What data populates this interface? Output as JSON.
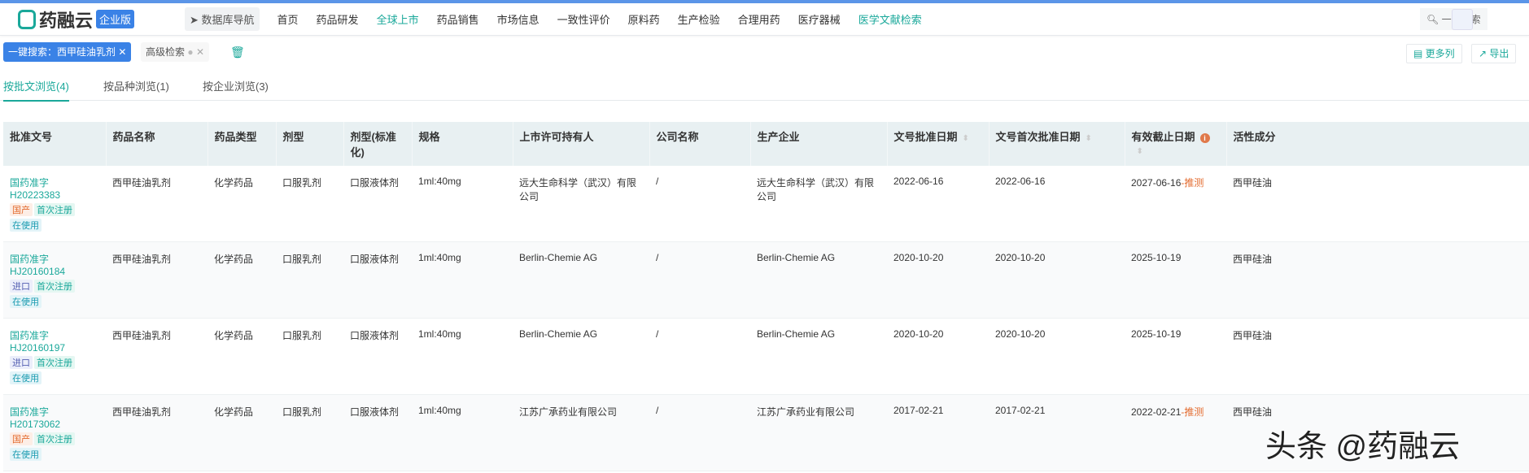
{
  "header": {
    "logo": "药融云",
    "edition": "企业版",
    "db_nav": "数据库导航",
    "nav": [
      "首页",
      "药品研发",
      "全球上市",
      "药品销售",
      "市场信息",
      "一致性评价",
      "原料药",
      "生产检验",
      "合理用药",
      "医疗器械",
      "医学文献检索"
    ],
    "active_nav": "全球上市",
    "search": "一键搜索"
  },
  "filters": {
    "chip": "一键搜索：西甲硅油乳剂",
    "advanced": "高级检索",
    "more_cols": "更多列",
    "export": "导出"
  },
  "tabs": [
    "按批文浏览(4)",
    "按品种浏览(1)",
    "按企业浏览(3)"
  ],
  "table": {
    "columns": [
      "批准文号",
      "药品名称",
      "药品类型",
      "剂型",
      "剂型(标准化)",
      "规格",
      "上市许可持有人",
      "公司名称",
      "生产企业",
      "文号批准日期",
      "文号首次批准日期",
      "有效截止日期",
      "活性成分"
    ],
    "rows": [
      {
        "no": "国药准字H20223383",
        "tags": [
          "国产",
          "首次注册",
          "在使用"
        ],
        "name": "西甲硅油乳剂",
        "type": "化学药品",
        "form": "口服乳剂",
        "form_std": "口服液体剂",
        "spec": "1ml:40mg",
        "holder": "远大生命科学（武汉）有限公司",
        "company": "/",
        "maker": "远大生命科学（武汉）有限公司",
        "date": "2022-06-16",
        "first_date": "2022-06-16",
        "expire": "2027-06-16",
        "guess": "-推测",
        "active": "西甲硅油"
      },
      {
        "no": "国药准字HJ20160184",
        "tags": [
          "进口",
          "首次注册",
          "在使用"
        ],
        "name": "西甲硅油乳剂",
        "type": "化学药品",
        "form": "口服乳剂",
        "form_std": "口服液体剂",
        "spec": "1ml:40mg",
        "holder": "Berlin-Chemie AG",
        "company": "/",
        "maker": "Berlin-Chemie AG",
        "date": "2020-10-20",
        "first_date": "2020-10-20",
        "expire": "2025-10-19",
        "guess": "",
        "active": "西甲硅油"
      },
      {
        "no": "国药准字HJ20160197",
        "tags": [
          "进口",
          "首次注册",
          "在使用"
        ],
        "name": "西甲硅油乳剂",
        "type": "化学药品",
        "form": "口服乳剂",
        "form_std": "口服液体剂",
        "spec": "1ml:40mg",
        "holder": "Berlin-Chemie AG",
        "company": "/",
        "maker": "Berlin-Chemie AG",
        "date": "2020-10-20",
        "first_date": "2020-10-20",
        "expire": "2025-10-19",
        "guess": "",
        "active": "西甲硅油"
      },
      {
        "no": "国药准字H20173062",
        "tags": [
          "国产",
          "首次注册",
          "在使用"
        ],
        "name": "西甲硅油乳剂",
        "type": "化学药品",
        "form": "口服乳剂",
        "form_std": "口服液体剂",
        "spec": "1ml:40mg",
        "holder": "江苏广承药业有限公司",
        "company": "/",
        "maker": "江苏广承药业有限公司",
        "date": "2017-02-21",
        "first_date": "2017-02-21",
        "expire": "2022-02-21",
        "guess": "-推测",
        "active": "西甲硅油"
      }
    ]
  },
  "watermark": "头条 @药融云"
}
